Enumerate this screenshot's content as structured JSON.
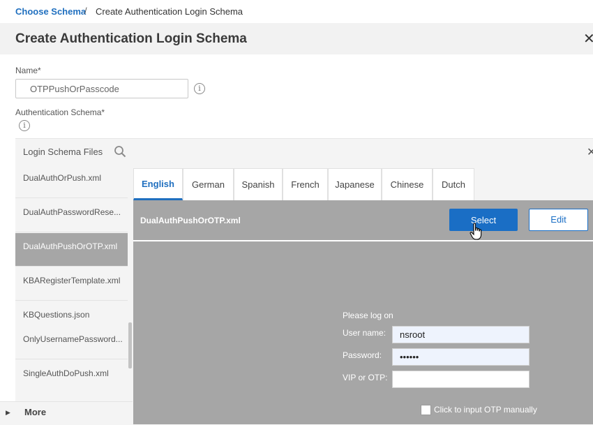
{
  "breadcrumb": {
    "link": "Choose Schema",
    "separator": "/",
    "current": "Create Authentication Login Schema"
  },
  "header": {
    "title": "Create Authentication Login Schema",
    "close": "✕"
  },
  "form": {
    "name_label": "Name*",
    "name_value": "OTPPushOrPasscode",
    "schema_label": "Authentication Schema*",
    "info_glyph": "i"
  },
  "files": {
    "header": "Login Schema Files",
    "close": "✕",
    "items": [
      {
        "label": "DualAuthOrPush.xml"
      },
      {
        "label": "DualAuthPasswordRese..."
      },
      {
        "label": "DualAuthPushOrOTP.xml",
        "active": true
      },
      {
        "label": "KBARegisterTemplate.xml"
      },
      {
        "label": "KBQuestions.json"
      },
      {
        "label": "OnlyUsernamePassword..."
      },
      {
        "label": "SingleAuthDoPush.xml"
      }
    ],
    "more": "More"
  },
  "tabs": [
    {
      "label": "English",
      "active": true
    },
    {
      "label": "German"
    },
    {
      "label": "Spanish"
    },
    {
      "label": "French"
    },
    {
      "label": "Japanese"
    },
    {
      "label": "Chinese"
    },
    {
      "label": "Dutch"
    }
  ],
  "preview": {
    "filename": "DualAuthPushOrOTP.xml",
    "select": "Select",
    "edit": "Edit",
    "login": {
      "title": "Please log on",
      "user_label": "User name:",
      "user_value": "nsroot",
      "pass_label": "Password:",
      "pass_value": "nsroot",
      "otp_label": "VIP or OTP:",
      "otp_value": "",
      "checkbox_label": "Click to input OTP manually"
    }
  },
  "colors": {
    "accent": "#1a6ec5",
    "preview_bg": "#a6a6a6",
    "active_file": "#a6a6a6"
  }
}
